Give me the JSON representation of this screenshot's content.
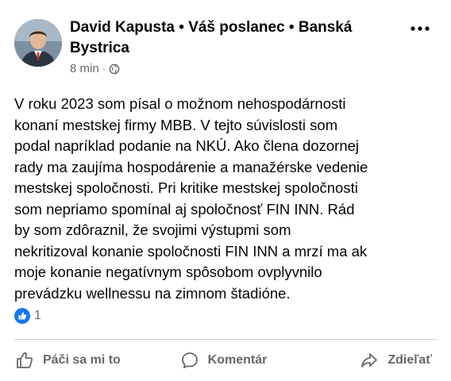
{
  "post": {
    "author": "David Kapusta • Váš poslanec • Banská Bystrica",
    "time": "8 min",
    "visibility_icon": "globe-icon",
    "more_icon": "more-options-icon",
    "text": "V roku 2023 som písal o možnom nehospodárnosti\nkonaní mestskej firmy MBB. V tejto súvislosti som\npodal  napríklad podanie na NKÚ. Ako člena dozornej\nrady ma zaujíma hospodárenie a manažérske vedenie\nmestskej spoločnosti. Pri kritike mestskej spoločnosti\nsom nepriamo spomínal aj spoločnosť FIN INN. Rád\nby som zdôraznil, že svojimi výstupmi som\nnekritizoval konanie spoločnosti FIN INN a mrzí ma ak\nmoje konanie negatívnym spôsobom ovplyvnilo\nprevádzku wellnessu na zimnom štadióne."
  },
  "reactions": {
    "icon": "like-reaction-icon",
    "count": "1",
    "color": "#1877f2"
  },
  "actions": {
    "like_label": "Páči sa mi to",
    "comment_label": "Komentár",
    "share_label": "Zdieľať"
  },
  "colors": {
    "text": "#050505",
    "secondary": "#65676b",
    "divider": "#ced0d4"
  }
}
